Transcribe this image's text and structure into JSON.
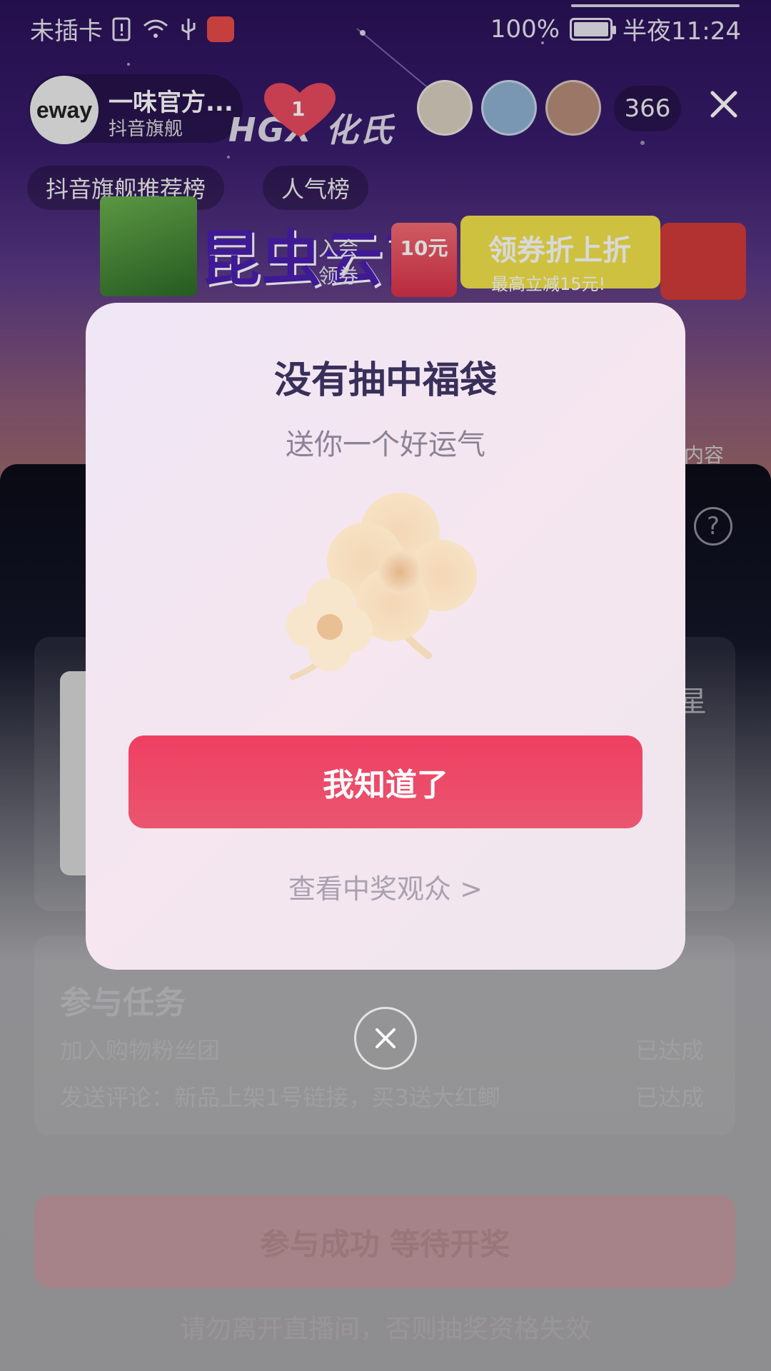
{
  "status_bar": {
    "carrier": "未插卡",
    "battery": "100%",
    "time": "半夜11:24"
  },
  "header": {
    "host_avatar_text": "eway",
    "host_name": "一味官方...",
    "host_sub": "抖音旗舰",
    "like_count": "1",
    "brand_text": "HGX 化氏",
    "viewer_count": "366"
  },
  "tags": [
    "抖音旗舰推荐榜",
    "人气榜"
  ],
  "banner": {
    "title": "昆虫云商",
    "coupon_label_1": "入会",
    "coupon_label_2": "领券",
    "coupon_value": "10元",
    "promo_title": "领券折上折",
    "promo_sub": "最高立减15元!"
  },
  "background": {
    "side_text": "内容",
    "help_icon": "?",
    "star_text": "星",
    "task_title": "参与任务",
    "tasks": [
      {
        "label": "加入购物粉丝团",
        "status": "已达成"
      },
      {
        "label": "发送评论：新品上架1号链接，买3送大红鲫",
        "status": "已达成"
      }
    ],
    "join_button": "参与成功 等待开奖",
    "warning": "请勿离开直播间，否则抽奖资格失效"
  },
  "modal": {
    "title": "没有抽中福袋",
    "subtitle": "送你一个好运气",
    "confirm": "我知道了",
    "view_winners": "查看中奖观众 >"
  },
  "colors": {
    "accent": "#EF3F62",
    "modal_title": "#38305A",
    "modal_bg": "#F2E7F2"
  }
}
